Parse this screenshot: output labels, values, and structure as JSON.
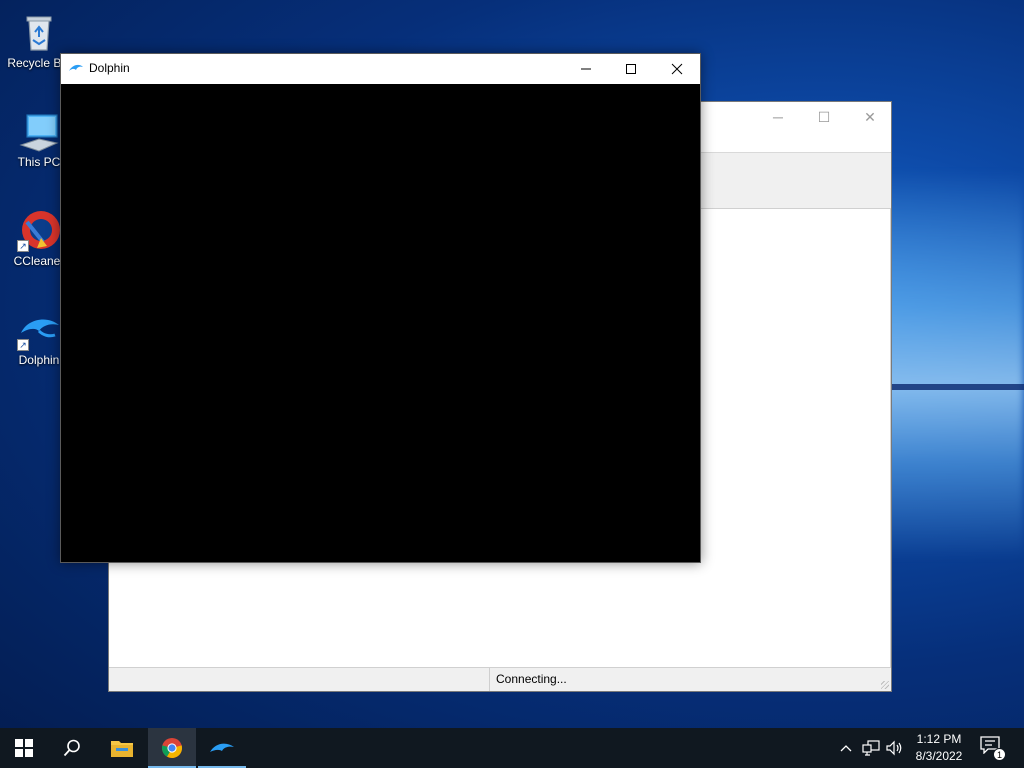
{
  "desktop": {
    "icons": [
      {
        "label": "Recycle Bin",
        "icon": "recycle-bin-icon"
      },
      {
        "label": "This PC",
        "icon": "computer-icon"
      },
      {
        "label": "CCleaner",
        "icon": "ccleaner-icon"
      },
      {
        "label": "Dolphin",
        "icon": "dolphin-icon"
      }
    ]
  },
  "background_window": {
    "status_text": "Connecting..."
  },
  "dolphin_window": {
    "title": "Dolphin",
    "controls": [
      "minimize",
      "maximize",
      "close"
    ]
  },
  "taskbar": {
    "apps": [
      {
        "name": "start",
        "icon": "windows-start-icon"
      },
      {
        "name": "search",
        "icon": "search-icon"
      },
      {
        "name": "file-explorer",
        "icon": "folder-icon"
      },
      {
        "name": "chrome",
        "icon": "chrome-icon",
        "active": true
      },
      {
        "name": "dolphin",
        "icon": "dolphin-icon",
        "running": true
      }
    ],
    "clock": {
      "time": "1:12 PM",
      "date": "8/3/2022"
    },
    "notification_count": "1"
  },
  "colors": {
    "accent": "#76b9ed",
    "taskbar": "#101820",
    "dolphin_blue": "#2a9df4"
  }
}
